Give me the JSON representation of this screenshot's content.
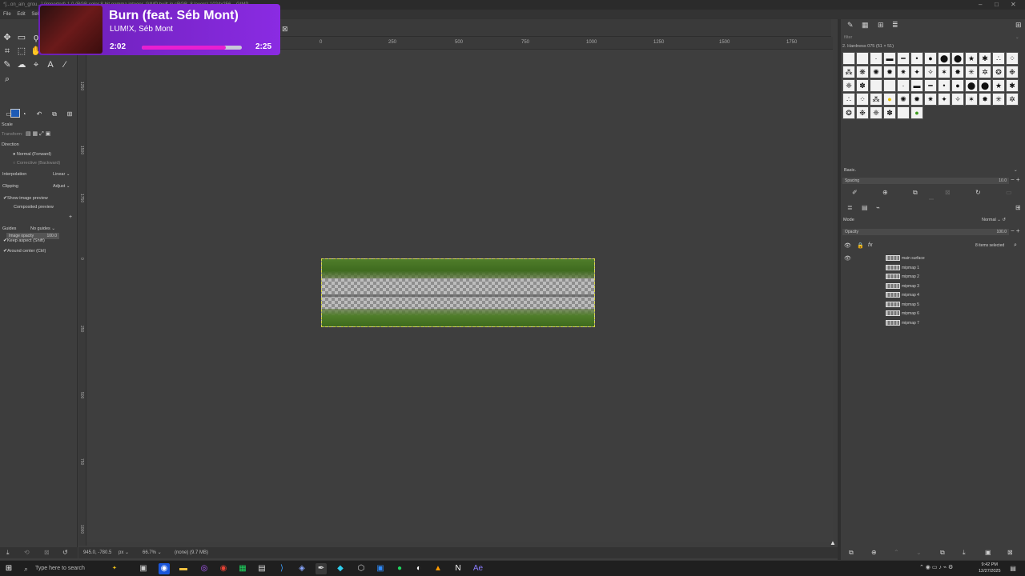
{
  "window": {
    "title": "*[...on_ain_grou...] (imported)-1.0 (RGB color 8-bit gamma integer, GIMP built-in sRGB, 8 layers) 1024x256 – GIMP"
  },
  "menu": [
    "File",
    "Edit",
    "Select"
  ],
  "toolbox": {
    "tool_icons": [
      "move-icon",
      "rect-select-icon",
      "lasso-icon",
      "fuzzy-select-icon",
      "crop-icon",
      "transform-icon",
      "warp-icon",
      "paint-icon",
      "text-icon",
      "color-picker-icon",
      "zoom-icon"
    ],
    "fg_color": "#1e5bb5",
    "bg_color": "#2e2e2e",
    "options_title": "Scale",
    "transform_label": "Transform:",
    "direction_label": "Direction",
    "direction_normal": "Normal (Forward)",
    "direction_corrective": "Corrective (Backward)",
    "interpolation_label": "Interpolation",
    "interpolation_value": "Linear",
    "clipping_label": "Clipping",
    "clipping_value": "Adjust",
    "show_preview": "Show image preview",
    "composited_preview": "Composited preview",
    "image_opacity_label": "Image opacity",
    "image_opacity_value": "100.0",
    "guides_label": "Guides",
    "guides_value": "No guides",
    "keep_aspect": "Keep aspect (Shift)",
    "around_center": "Around center (Ctrl)"
  },
  "ruler": {
    "top": [
      "0",
      "250",
      "500",
      "750",
      "1000",
      "1250",
      "1500",
      "1750"
    ],
    "left": [
      "0",
      "250",
      "500",
      "750",
      "1000",
      "1250",
      "1500",
      "1750"
    ]
  },
  "status": {
    "coords": "945.0, -780.5",
    "unit": "px",
    "zoom": "66.7%",
    "info": "(none) (9.7 MB)"
  },
  "brushes": {
    "filter_placeholder": "filter",
    "current_brush": "2. Hardness 075 (51 × 51)",
    "tag": "Basic.",
    "spacing_label": "Spacing",
    "spacing_value": "10.0"
  },
  "layers": {
    "mode_label": "Mode",
    "mode_value": "Normal",
    "opacity_label": "Opacity",
    "opacity_value": "100.0",
    "selected_count": "8 items selected",
    "items": [
      "main surface",
      "mipmap 1",
      "mipmap 2",
      "mipmap 3",
      "mipmap 4",
      "mipmap 5",
      "mipmap 6",
      "mipmap 7"
    ]
  },
  "media": {
    "title": "Burn (feat. Séb Mont)",
    "artist": "LUM!X, Séb Mont",
    "current": "2:02",
    "total": "2:25",
    "progress_fraction": 0.84,
    "accent": "#e81fd0"
  },
  "taskbar": {
    "search_placeholder": "Type here to search",
    "time": "9:42 PM",
    "date": "12/27/2025"
  }
}
